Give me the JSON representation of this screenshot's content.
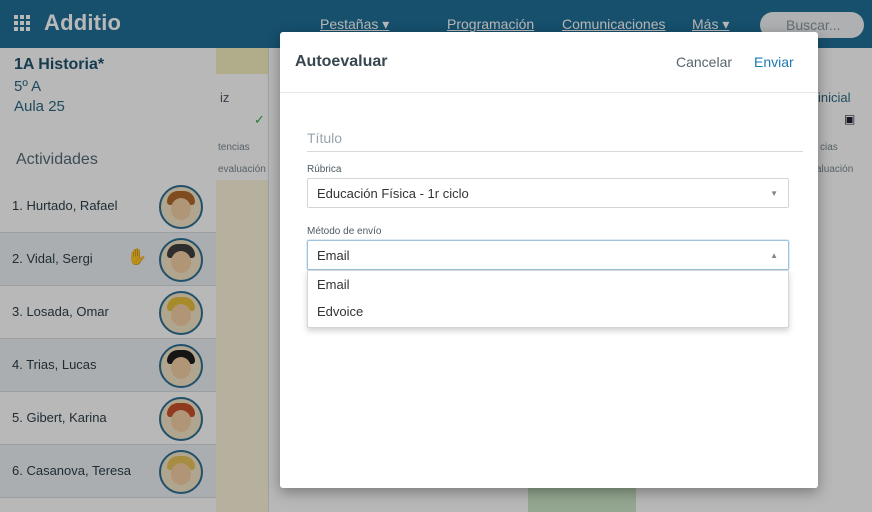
{
  "header": {
    "brand": "Additio",
    "nav": [
      "Pestañas ▾",
      "Programación",
      "Comunicaciones",
      "Más ▾"
    ],
    "search_placeholder": "Buscar..."
  },
  "class_info": {
    "title": "1A Historia*",
    "group": "5º A",
    "room": "Aula 25",
    "activities_label": "Actividades"
  },
  "students": [
    {
      "name": "1. Hurtado, Rafael"
    },
    {
      "name": "2. Vidal, Sergi"
    },
    {
      "name": "3. Losada, Omar"
    },
    {
      "name": "4. Trias, Lucas"
    },
    {
      "name": "5. Gibert, Karina"
    },
    {
      "name": "6. Casanova, Teresa"
    }
  ],
  "background_columns": {
    "col1_header": "iz",
    "col1_sub1": "tencias",
    "col1_sub2": "evaluación",
    "col2_header": "inicial",
    "col2_sub1": "cias",
    "col2_sub2": "aluación"
  },
  "modal": {
    "title": "Autoevaluar",
    "cancel": "Cancelar",
    "send": "Enviar",
    "title_placeholder": "Título",
    "rubrica_label": "Rúbrica",
    "rubrica_value": "Educación Física - 1r ciclo",
    "metodo_label": "Método de envío",
    "metodo_value": "Email",
    "metodo_options": [
      "Email",
      "Edvoice"
    ]
  },
  "colors": {
    "topbar": "#1f6f98",
    "accent": "#1d7ab1"
  }
}
